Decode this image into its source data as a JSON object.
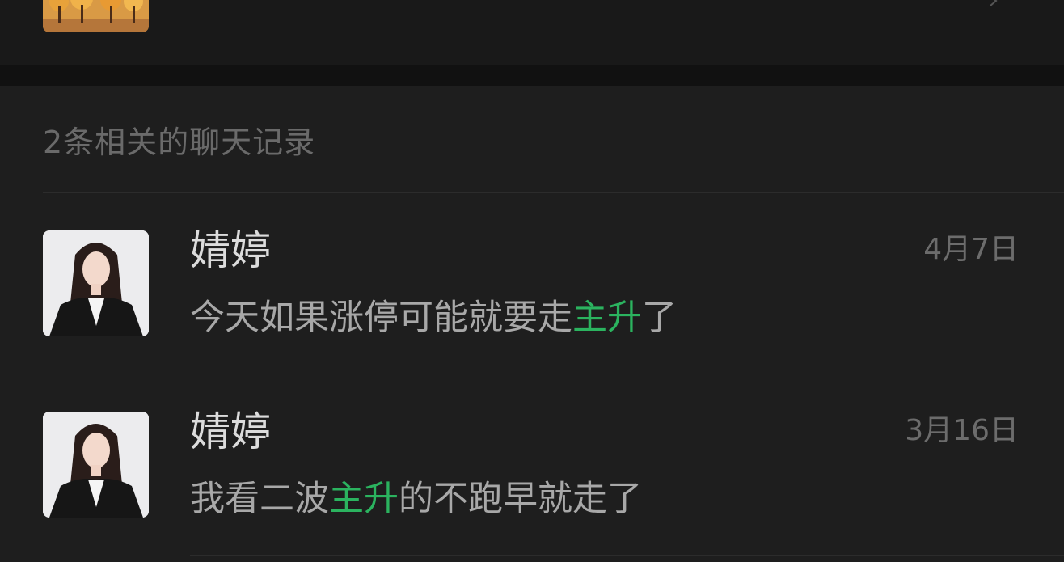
{
  "section_title": "2条相关的聊天记录",
  "messages": [
    {
      "sender": "婧婷",
      "date": "4月7日",
      "preview_before": "今天如果涨停可能就要走",
      "preview_highlight": "主升",
      "preview_after": "了"
    },
    {
      "sender": "婧婷",
      "date": "3月16日",
      "preview_before": "我看二波",
      "preview_highlight": "主升",
      "preview_after": "的不跑早就走了"
    }
  ],
  "colors": {
    "highlight": "#2bb35f",
    "background": "#1e1e1e",
    "sender_text": "#dcdcdc",
    "muted_text": "#6c6c6c"
  }
}
